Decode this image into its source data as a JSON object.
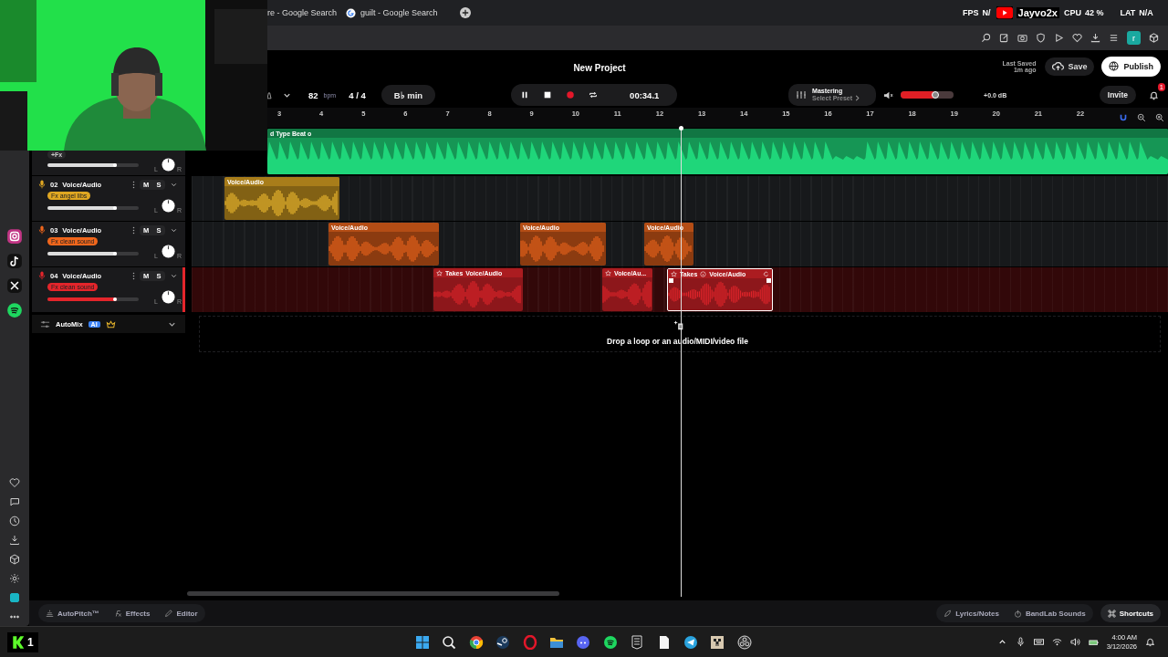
{
  "browser": {
    "tabs": [
      {
        "label": "re - Google Search",
        "kind": "plain"
      },
      {
        "label": "guilt - Google Search",
        "kind": "google"
      }
    ],
    "avatar": "r"
  },
  "stream_overlay": {
    "fps_label": "FPS",
    "fps_value": "N/",
    "channel": "Jayvo2x",
    "cpu_label": "CPU",
    "cpu_value": "42 %",
    "lat_label": "LAT",
    "lat_value": "N/A"
  },
  "project": {
    "title": "New Project",
    "tempo": "82",
    "tempo_unit": "bpm",
    "time_signature": "4 / 4",
    "key": "B♭ min",
    "playing": true,
    "time": "00:34.1"
  },
  "mastering": {
    "title": "Mastering",
    "preset": "Select Preset"
  },
  "volume": {
    "level": 0.66,
    "reading": "+0.0 dB"
  },
  "save_status": {
    "label": "Last Saved",
    "time": "1m ago"
  },
  "buttons": {
    "save": "Save",
    "publish": "Publish",
    "invite": "Invite"
  },
  "notifications": {
    "count": "1"
  },
  "ruler": [
    "3",
    "4",
    "5",
    "6",
    "7",
    "8",
    "9",
    "10",
    "11",
    "12",
    "13",
    "14",
    "15",
    "16",
    "17",
    "18",
    "19",
    "20",
    "21",
    "22"
  ],
  "tracks": [
    {
      "tag": "+Fx",
      "color": "#1fd67a",
      "selected": false,
      "fader": {
        "level": 0.76
      },
      "pan_left": "L",
      "pan_right": "R",
      "clips": [
        {
          "label": "d Type Beat o",
          "kind": "beat",
          "selected": false
        }
      ]
    },
    {
      "number": "02",
      "name": "Voice/Audio",
      "mute": "M",
      "solo": "S",
      "tag": "Fx angel libs",
      "color": "#e0a722",
      "selected": false,
      "fader": {
        "level": 0.76
      },
      "pan_left": "L",
      "pan_right": "R",
      "clips": [
        {
          "label": "Voice/Audio",
          "kind": "audio",
          "selected": false
        }
      ]
    },
    {
      "number": "03",
      "name": "Voice/Audio",
      "mute": "M",
      "solo": "S",
      "tag": "Fx clean sound",
      "color": "#f0661c",
      "selected": false,
      "fader": {
        "level": 0.76
      },
      "pan_left": "L",
      "pan_right": "R",
      "clips": [
        {
          "label": "Voice/Audio",
          "kind": "audio",
          "selected": false
        },
        {
          "label": "Voice/Audio",
          "kind": "audio",
          "selected": false
        },
        {
          "label": "Voice/Audio",
          "kind": "audio",
          "selected": false
        }
      ]
    },
    {
      "number": "04",
      "name": "Voice/Audio",
      "mute": "M",
      "solo": "S",
      "tag": "Fx clean sound",
      "color": "#e4252b",
      "selected": true,
      "fader": {
        "level": 0.76
      },
      "pan_left": "L",
      "pan_right": "R",
      "clips": [
        {
          "takes": "Takes",
          "label": "Voice/Audio",
          "kind": "take",
          "selected": false
        },
        {
          "label": "Voice/Au...",
          "kind": "take",
          "selected": false
        },
        {
          "takes": "Takes",
          "label": "Voice/Audio",
          "kind": "take",
          "selected": true
        }
      ]
    }
  ],
  "automix": {
    "label": "AutoMix",
    "badge": "AI"
  },
  "drop_hint": "Drop a loop or an audio/MIDI/video file",
  "bottom_tools": [
    "AutoPitch™",
    "Effects",
    "Editor"
  ],
  "panels": [
    "Lyrics/Notes",
    "BandLab Sounds"
  ],
  "shortcuts": "Shortcuts",
  "taskbar": {
    "badge": "1",
    "time": "4:00 AM",
    "date": "3/12/2026"
  }
}
